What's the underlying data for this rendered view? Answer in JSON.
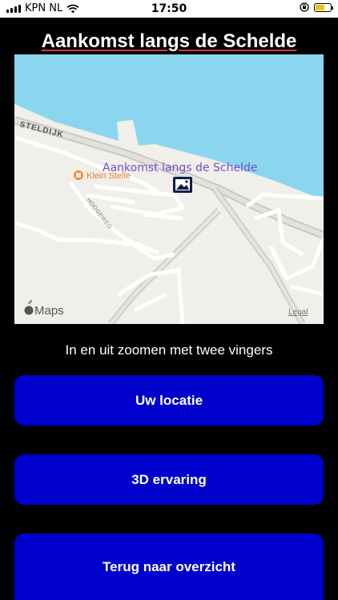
{
  "status_bar": {
    "carrier": "KPN NL",
    "time": "17:50",
    "battery_color": "#f2c200"
  },
  "page": {
    "title": "Aankomst langs de Schelde"
  },
  "map": {
    "pin_label": "Aankomst langs de Schelde",
    "poi_label": "Klein Stelle",
    "street_steldijk": "STELDIJK",
    "street_hoogeweg": "HOOGEWEG",
    "brand": "Maps",
    "legal": "Legal",
    "water_color": "#8ad6ee",
    "land_color": "#f1efe9",
    "pin_label_color": "#7b4bc9"
  },
  "hint": "In en uit zoomen met twee vingers",
  "buttons": {
    "location": "Uw locatie",
    "experience": "3D ervaring",
    "overview": "Terug naar overzicht",
    "color": "#0000cc"
  }
}
